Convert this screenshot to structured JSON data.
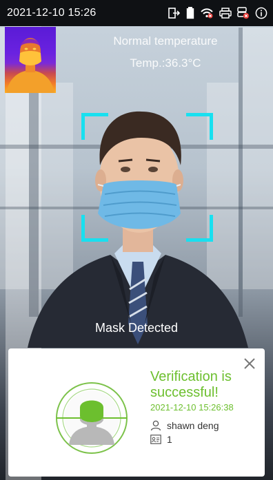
{
  "status_bar": {
    "datetime": "2021-12-10 15:26",
    "icons": [
      "exit-icon",
      "battery-icon",
      "wifi-off-icon",
      "printer-icon",
      "database-alert-icon",
      "info-icon"
    ]
  },
  "temperature": {
    "status": "Normal temperature",
    "reading": "Temp.:36.3°C"
  },
  "detection": {
    "label": "Mask Detected",
    "frame_color": "#18e0f0"
  },
  "result": {
    "title": "Verification is successful!",
    "timestamp": "2021-12-10 15:26:38",
    "user_name": "shawn deng",
    "user_id": "1",
    "accent_color": "#6cbf2e"
  }
}
